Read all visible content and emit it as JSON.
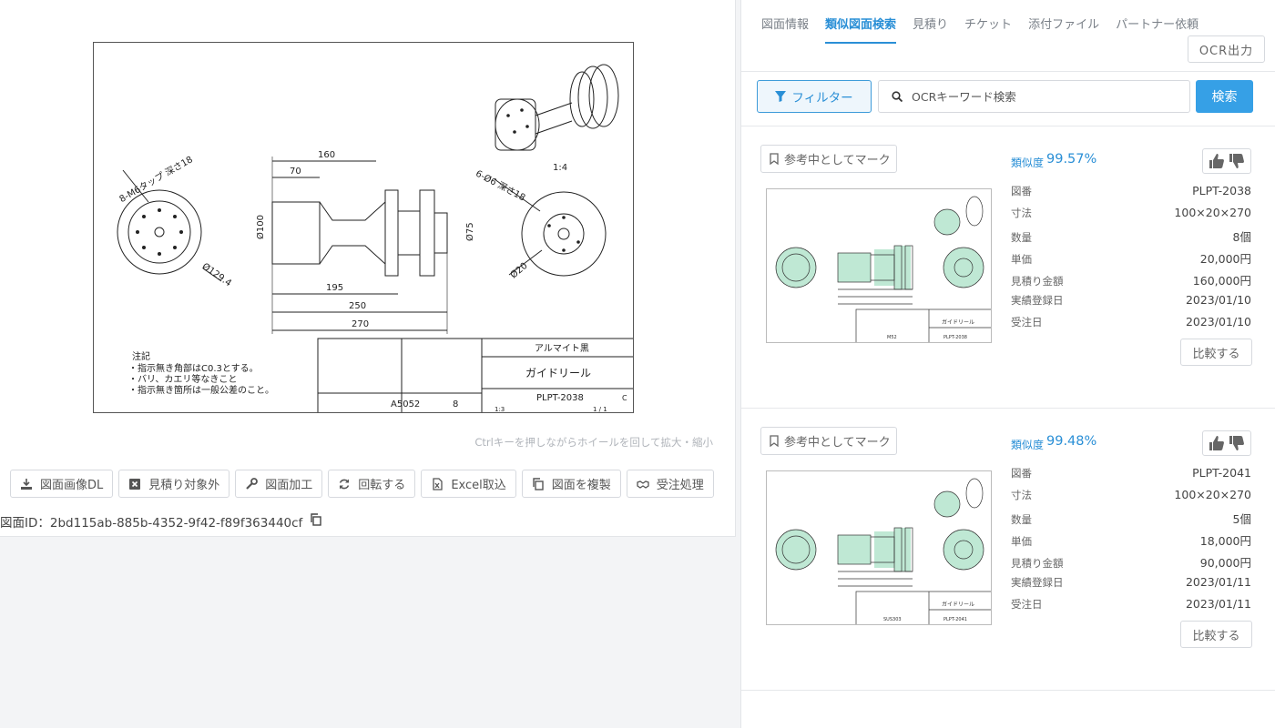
{
  "drawing": {
    "scale_label": "1:4",
    "dims": {
      "d160": "160",
      "d70": "70",
      "d195": "195",
      "d250": "250",
      "d270": "270",
      "d100": "Ø100",
      "d75": "Ø75",
      "d20": "Ø20",
      "d129": "Ø129.4",
      "tap": "8-M6タップ 深さ18",
      "hole": "6-Ø6 深さ18"
    },
    "notes_title": "注記",
    "notes": [
      "・指示無き角部はC0.3とする。",
      "・バリ、カエリ等なきこと",
      "・指示無き箇所は一般公差のこと。"
    ],
    "title_block": {
      "surface": "アルマイト黒",
      "name": "ガイドリール",
      "number": "PLPT-2038",
      "material": "A5052",
      "quantity": "8",
      "scale": "1:3",
      "sheet": "1 / 1",
      "rev": "C"
    }
  },
  "zoom_hint": "Ctrlキーを押しながらホイールを回して拡大・縮小",
  "toolbar": [
    {
      "label": "図面画像DL",
      "icon": "download-icon"
    },
    {
      "label": "見積り対象外",
      "icon": "x-square-icon"
    },
    {
      "label": "図面加工",
      "icon": "wrench-icon"
    },
    {
      "label": "回転する",
      "icon": "rotate-icon"
    },
    {
      "label": "Excel取込",
      "icon": "excel-file-icon"
    },
    {
      "label": "図面を複製",
      "icon": "copy-icon"
    },
    {
      "label": "受注処理",
      "icon": "handshake-icon"
    }
  ],
  "drawing_id": "図面ID：2bd115ab-885b-4352-9f42-f89f363440cf",
  "tabs": [
    {
      "label": "図面情報",
      "active": false
    },
    {
      "label": "類似図面検索",
      "active": true
    },
    {
      "label": "見積り",
      "active": false
    },
    {
      "label": "チケット",
      "active": false
    },
    {
      "label": "添付ファイル",
      "active": false
    },
    {
      "label": "パートナー依頼",
      "active": false
    }
  ],
  "ocr_output_label": "OCR出力",
  "filter_label": "フィルター",
  "search": {
    "placeholder": "OCRキーワード検索",
    "button": "検索"
  },
  "results": [
    {
      "mark_label": "参考中としてマーク",
      "similarity_label": "類似度",
      "similarity": "99.57%",
      "thumb_number": "PLPT-2038",
      "thumb_material": "M52",
      "fields": [
        {
          "label": "図番",
          "value": "PLPT-2038"
        },
        {
          "label": "寸法",
          "value": "100×20×270"
        },
        {
          "label": "数量",
          "value": "8個"
        },
        {
          "label": "単価",
          "value": "20,000円"
        },
        {
          "label": "見積り金額",
          "value": "160,000円"
        },
        {
          "label": "実績登録日",
          "value": "2023/01/10"
        },
        {
          "label": "受注日",
          "value": "2023/01/10"
        }
      ],
      "compare_label": "比較する"
    },
    {
      "mark_label": "参考中としてマーク",
      "similarity_label": "類似度",
      "similarity": "99.48%",
      "thumb_number": "PLPT-2041",
      "thumb_material": "SUS303",
      "fields": [
        {
          "label": "図番",
          "value": "PLPT-2041"
        },
        {
          "label": "寸法",
          "value": "100×20×270"
        },
        {
          "label": "数量",
          "value": "5個"
        },
        {
          "label": "単価",
          "value": "18,000円"
        },
        {
          "label": "見積り金額",
          "value": "90,000円"
        },
        {
          "label": "実績登録日",
          "value": "2023/01/11"
        },
        {
          "label": "受注日",
          "value": "2023/01/11"
        }
      ],
      "compare_label": "比較する"
    }
  ],
  "colors": {
    "accent": "#2a8fd6",
    "search_button": "#36a0e6",
    "highlight": "#bfe8d4"
  }
}
